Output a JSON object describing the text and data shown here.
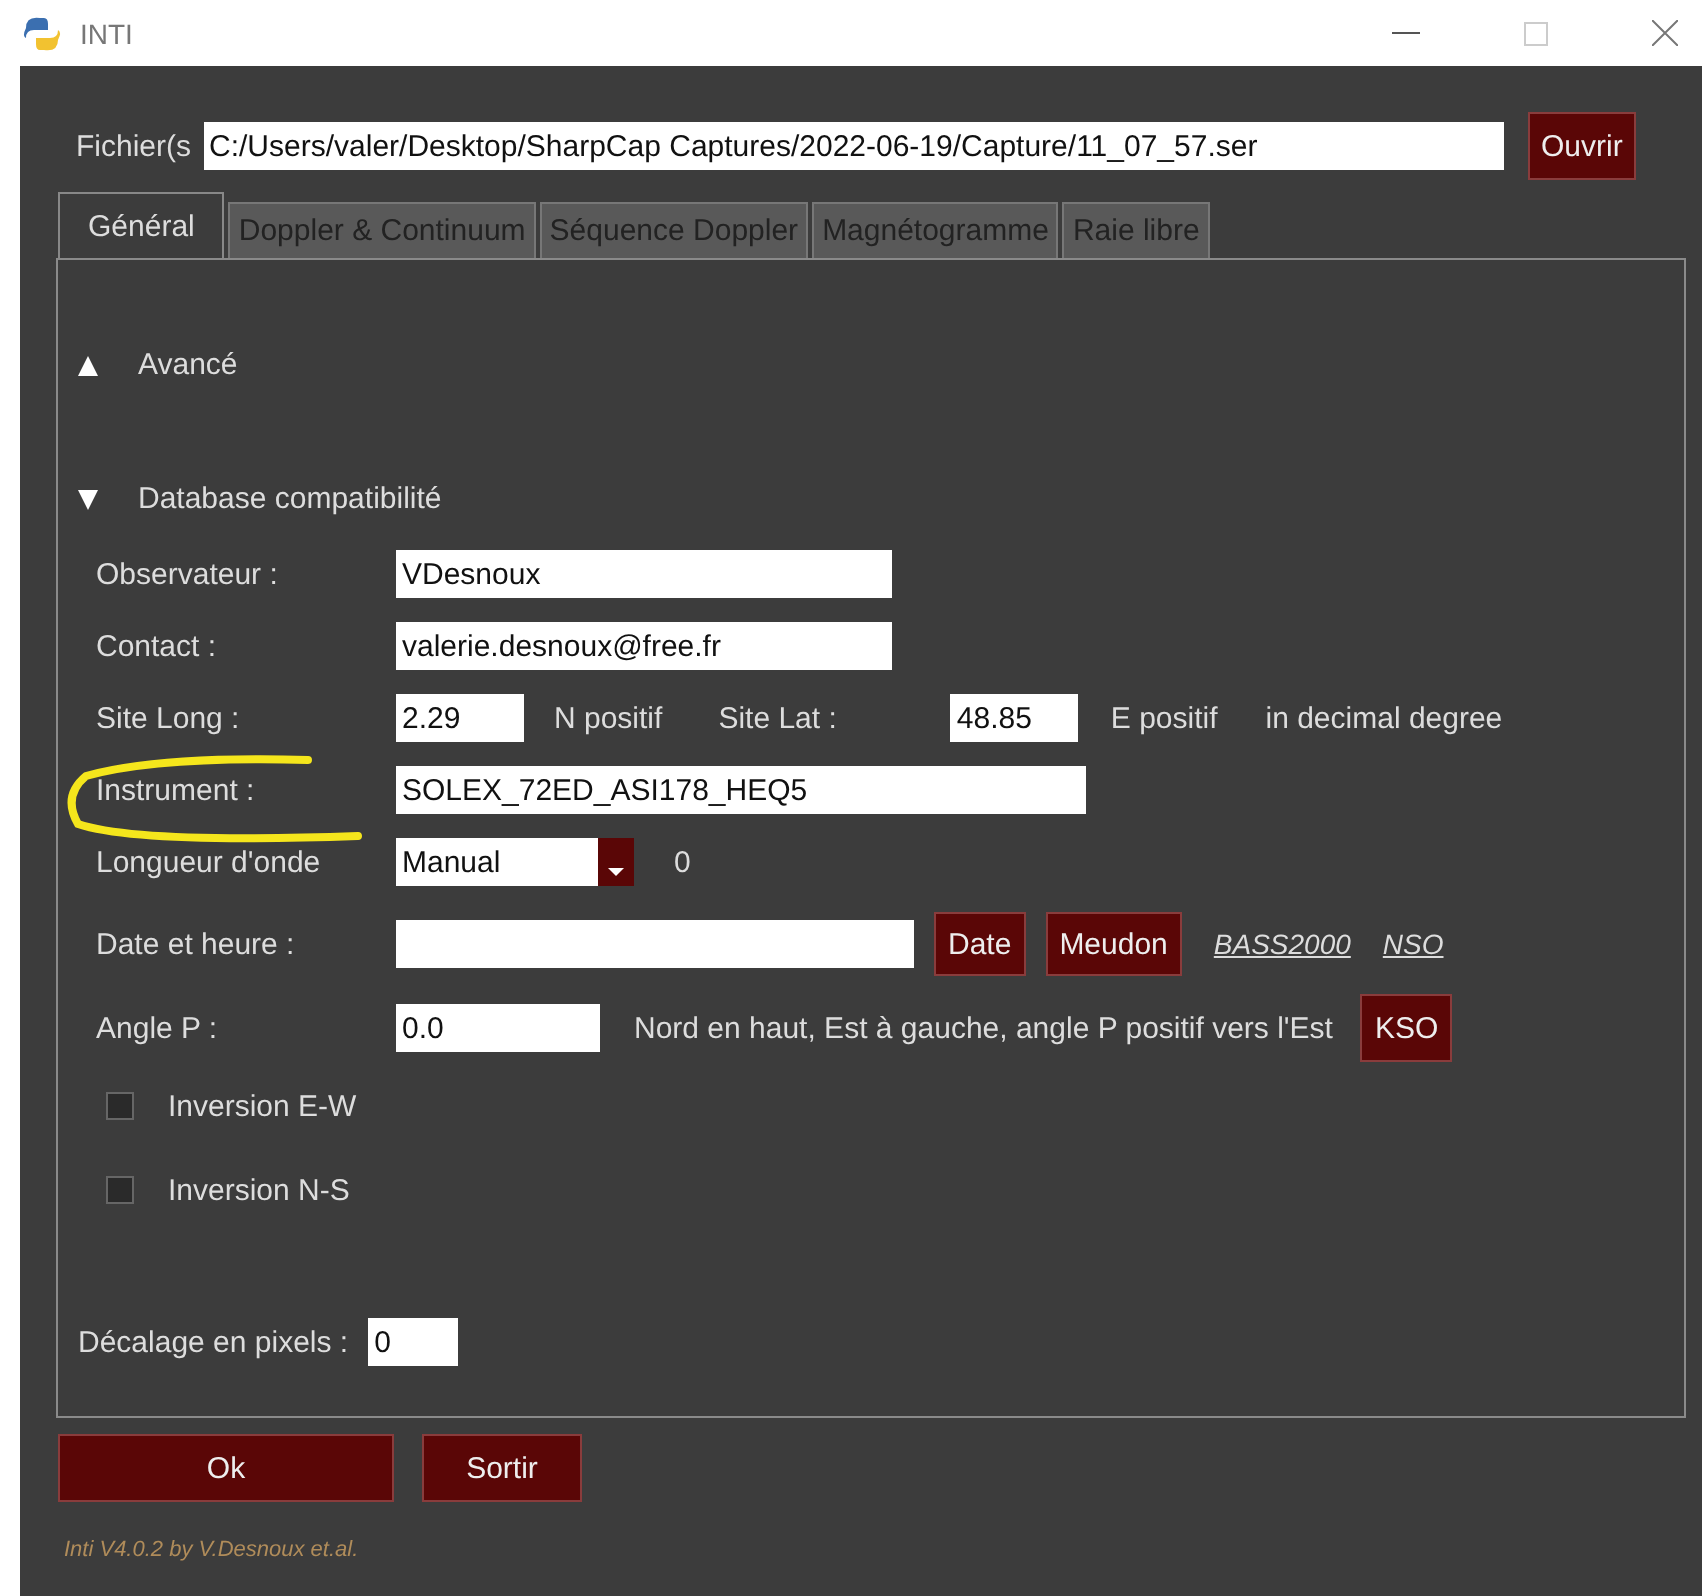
{
  "window": {
    "title": "INTI"
  },
  "file_row": {
    "label": "Fichier(s",
    "value": "C:/Users/valer/Desktop/SharpCap Captures/2022-06-19/Capture/11_07_57.ser",
    "button": "Ouvrir"
  },
  "tabs": [
    {
      "label": "Général",
      "selected": true
    },
    {
      "label": "Doppler & Continuum",
      "selected": false
    },
    {
      "label": "Séquence Doppler",
      "selected": false
    },
    {
      "label": "Magnétogramme",
      "selected": false
    },
    {
      "label": "Raie libre",
      "selected": false
    }
  ],
  "sections": [
    {
      "label": "Avancé",
      "expanded": false
    },
    {
      "label": "Database compatibilité",
      "expanded": true
    }
  ],
  "observer": {
    "label": "Observateur :",
    "value": "VDesnoux"
  },
  "contact": {
    "label": "Contact :",
    "value": "valerie.desnoux@free.fr"
  },
  "site": {
    "long_label": "Site Long :",
    "long_value": "2.29",
    "long_unit": "N positif",
    "lat_label": "Site Lat :",
    "lat_value": "48.85",
    "lat_unit": "E positif",
    "note": "in decimal degree"
  },
  "instrument": {
    "label": "Instrument :",
    "value": "SOLEX_72ED_ASI178_HEQ5"
  },
  "wavelength": {
    "label": "Longueur d'onde",
    "value": "Manual",
    "reading": "0"
  },
  "date": {
    "label": "Date et heure :",
    "buttons": [
      "Date",
      "Meudon"
    ],
    "links": [
      "BASS2000",
      "NSO"
    ]
  },
  "angle": {
    "label": "Angle P :",
    "value": "0.0",
    "note": "Nord en haut, Est à gauche, angle P positif vers l'Est",
    "button": "KSO"
  },
  "checkboxes": [
    {
      "label": "Inversion E-W",
      "checked": false
    },
    {
      "label": "Inversion N-S",
      "checked": false
    }
  ],
  "offset": {
    "label": "Décalage en pixels :",
    "value": "0"
  },
  "buttons": [
    "Ok",
    "Sortir"
  ],
  "footer": "Inti V4.0.2 by V.Desnoux et.al."
}
